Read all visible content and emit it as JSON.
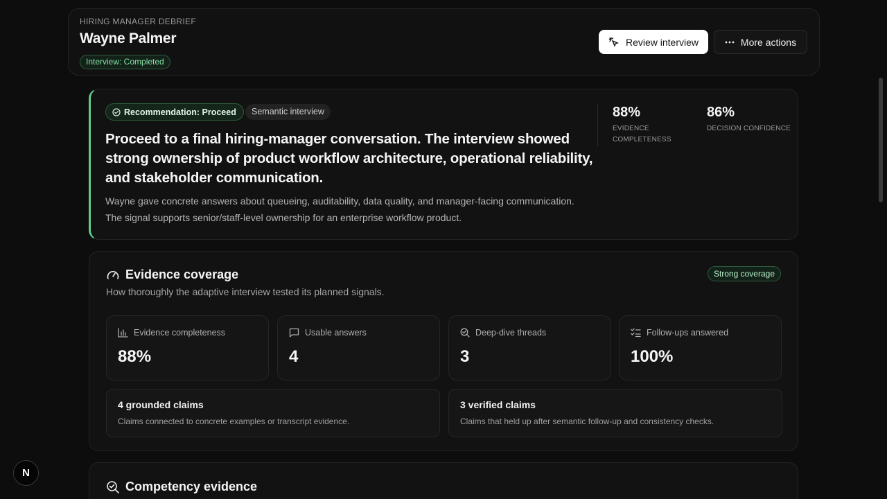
{
  "header": {
    "eyebrow": "HIRING MANAGER DEBRIEF",
    "candidate_name": "Wayne Palmer",
    "status": "Interview: Completed",
    "review_button": "Review interview",
    "more_button": "More actions"
  },
  "recommendation": {
    "badge": "Recommendation: Proceed",
    "type_badge": "Semantic interview",
    "headline": "Proceed to a final hiring-manager conversation. The interview showed strong ownership of product workflow architecture, operational reliability, and stakeholder communication.",
    "body": "Wayne gave concrete answers about queueing, auditability, data quality, and manager-facing communication. The signal supports senior/staff-level ownership for an enterprise workflow product.",
    "metrics": [
      {
        "value": "88%",
        "label_line1": "EVIDENCE",
        "label_line2": "COMPLETENESS"
      },
      {
        "value": "86%",
        "label_line1": "DECISION CONFIDENCE",
        "label_line2": ""
      }
    ]
  },
  "coverage": {
    "title": "Evidence coverage",
    "subtitle": "How thoroughly the adaptive interview tested its planned signals.",
    "badge": "Strong coverage",
    "stats": [
      {
        "label": "Evidence completeness",
        "value": "88%",
        "icon": "bar-chart-icon"
      },
      {
        "label": "Usable answers",
        "value": "4",
        "icon": "message-square-icon"
      },
      {
        "label": "Deep-dive threads",
        "value": "3",
        "icon": "search-check-icon"
      },
      {
        "label": "Follow-ups answered",
        "value": "100%",
        "icon": "list-checks-icon"
      }
    ],
    "claims": [
      {
        "title": "4 grounded claims",
        "desc": "Claims connected to concrete examples or transcript evidence."
      },
      {
        "title": "3 verified claims",
        "desc": "Claims that held up after semantic follow-up and consistency checks."
      }
    ]
  },
  "competency": {
    "title": "Competency evidence"
  },
  "floating": {
    "letter": "N"
  },
  "colors": {
    "accent_green": "#5fcf8a",
    "background": "#0d0d0d",
    "card": "#121212"
  }
}
